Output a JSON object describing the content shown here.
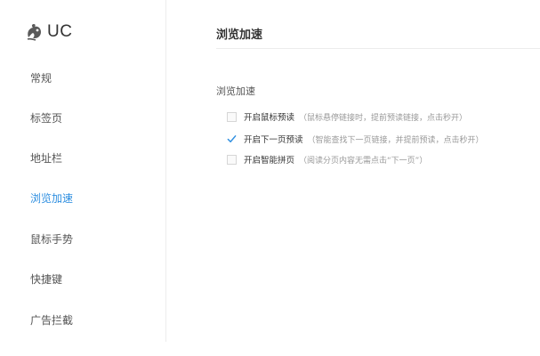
{
  "app": {
    "logo_text": "UC",
    "logo_icon": "uc-squirrel-logo"
  },
  "sidebar": {
    "items": [
      {
        "label": "常规",
        "active": false
      },
      {
        "label": "标签页",
        "active": false
      },
      {
        "label": "地址栏",
        "active": false
      },
      {
        "label": "浏览加速",
        "active": true
      },
      {
        "label": "鼠标手势",
        "active": false
      },
      {
        "label": "快捷键",
        "active": false
      },
      {
        "label": "广告拦截",
        "active": false
      }
    ]
  },
  "main": {
    "title": "浏览加速",
    "section_label": "浏览加速",
    "options": [
      {
        "label": "开启鼠标预读",
        "desc": "（鼠标悬停链接时，提前预读链接，点击秒开）",
        "checked": false
      },
      {
        "label": "开启下一页预读",
        "desc": "（智能查找下一页链接，并提前预读，点击秒开）",
        "checked": true
      },
      {
        "label": "开启智能拼页",
        "desc": "（阅读分页内容无需点击“下一页”）",
        "checked": false
      }
    ]
  },
  "colors": {
    "accent": "#2f8fe0",
    "text": "#333333",
    "muted": "#999999",
    "divider": "#ececec"
  }
}
